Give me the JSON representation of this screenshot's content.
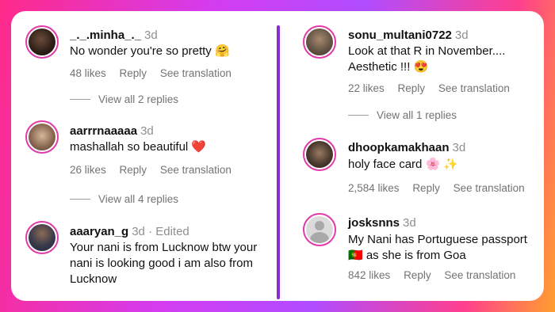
{
  "left": [
    {
      "username": "_._.minha_._",
      "time": "3d",
      "text": "No wonder you're so pretty 🤗",
      "likes": "48 likes",
      "reply": "Reply",
      "translate": "See translation",
      "view_replies": "View all 2 replies",
      "avatar_color": "#3a2b22"
    },
    {
      "username": "aarrrnaaaaa",
      "time": "3d",
      "text": "mashallah so beautiful ❤️",
      "likes": "26 likes",
      "reply": "Reply",
      "translate": "See translation",
      "view_replies": "View all 4 replies",
      "avatar_color": "#b89a7e"
    },
    {
      "username": "aaaryan_g",
      "time": "3d · Edited",
      "text": "Your nani is from Lucknow btw your nani is looking good i am also from Lucknow",
      "avatar_color": "#1f2a3a"
    }
  ],
  "right": [
    {
      "username": "sonu_multani0722",
      "time": "3d",
      "text": "Look at that R in November.... Aesthetic !!! 😍",
      "likes": "22 likes",
      "reply": "Reply",
      "translate": "See translation",
      "view_replies": "View all 1 replies",
      "avatar_color": "#6b5a4a"
    },
    {
      "username": "dhoopkamakhaan",
      "time": "3d",
      "text": "holy face card 🌸 ✨",
      "likes": "2,584 likes",
      "reply": "Reply",
      "translate": "See translation",
      "avatar_color": "#4a3a30"
    },
    {
      "username": "josksnns",
      "time": "3d",
      "text": "My Nani has Portuguese passport 🇵🇹 as she is from Goa",
      "likes": "842 likes",
      "reply": "Reply",
      "translate": "See translation",
      "avatar_color": "#c9c9c9"
    }
  ]
}
